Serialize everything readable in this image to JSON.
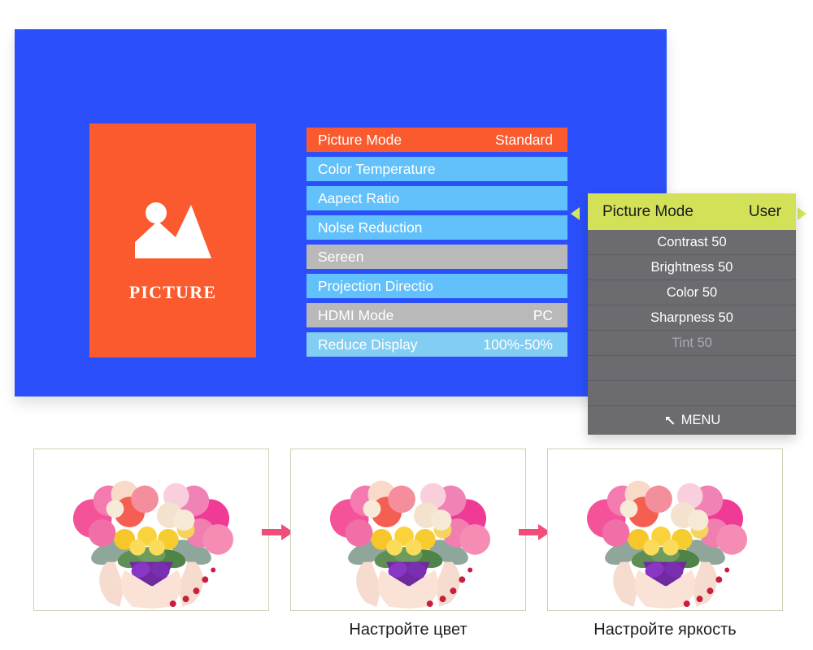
{
  "osd": {
    "background_color": "#2b4ffa",
    "picture_card": {
      "label": "PICTURE",
      "background_color": "#fa5a2d",
      "icon": "picture-mountain-icon"
    },
    "settings": [
      {
        "label": "Picture Mode",
        "value": "Standard",
        "style": "sel"
      },
      {
        "label": "Color Temperature",
        "value": "",
        "style": "blue"
      },
      {
        "label": "Aapect Ratio",
        "value": "",
        "style": "blue"
      },
      {
        "label": "Nolse Reduction",
        "value": "",
        "style": "blue"
      },
      {
        "label": "Sereen",
        "value": "",
        "style": "grey"
      },
      {
        "label": "Projection Directio",
        "value": "",
        "style": "blue"
      },
      {
        "label": "HDMI Mode",
        "value": "PC",
        "style": "grey"
      },
      {
        "label": "Reduce Display",
        "value": "100%-50%",
        "style": "blue2"
      }
    ]
  },
  "submenu": {
    "header": {
      "label": "Picture Mode",
      "value": "User",
      "background_color": "#d2e157"
    },
    "background_color": "#6b6b70",
    "rows": [
      {
        "text": "Contrast 50",
        "disabled": false
      },
      {
        "text": "Brightness 50",
        "disabled": false
      },
      {
        "text": "Color 50",
        "disabled": false
      },
      {
        "text": "Sharpness 50",
        "disabled": false
      },
      {
        "text": "Tint 50",
        "disabled": true
      },
      {
        "text": "",
        "disabled": false
      },
      {
        "text": "",
        "disabled": false
      }
    ],
    "footer": {
      "label": "MENU",
      "icon": "back-arrow-icon"
    }
  },
  "nav_arrows": {
    "left": "triangle-left-icon",
    "right": "triangle-right-icon",
    "down": "triangle-down-icon",
    "color": "#d6e85c"
  },
  "comparison": {
    "panels": [
      {
        "image": "heart-flower-bouquet-photo",
        "caption": ""
      },
      {
        "image": "heart-flower-bouquet-photo",
        "caption": "Настройте цвет"
      },
      {
        "image": "heart-flower-bouquet-photo",
        "caption": "Настройте яркость"
      }
    ],
    "step_arrow_color": "#ef4e78"
  }
}
